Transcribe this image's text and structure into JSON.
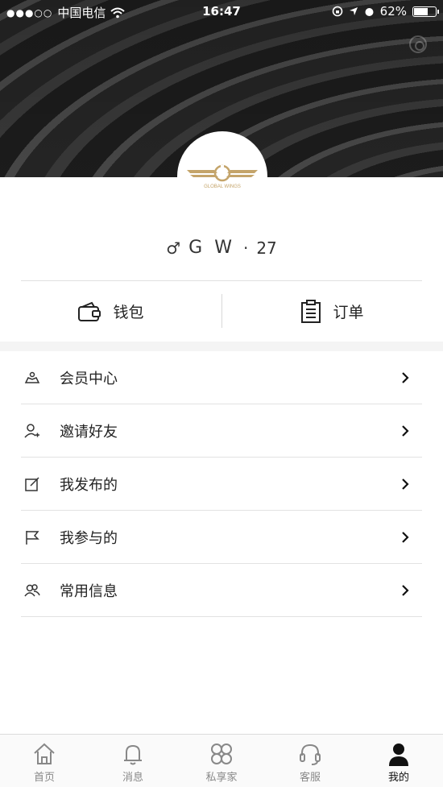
{
  "status_bar": {
    "carrier": "中国电信",
    "time": "16:47",
    "battery": "62%",
    "battery_level": 0.62
  },
  "profile": {
    "gender_symbol": "♂",
    "name": "G W",
    "separator": "·",
    "age": "27",
    "logo_text": "GLOBAL WINGS"
  },
  "quick_actions": [
    {
      "label": "钱包",
      "icon": "wallet-icon"
    },
    {
      "label": "订单",
      "icon": "clipboard-icon"
    }
  ],
  "menu": [
    {
      "label": "会员中心",
      "icon": "member-icon"
    },
    {
      "label": "邀请好友",
      "icon": "add-friend-icon"
    },
    {
      "label": "我发布的",
      "icon": "edit-icon"
    },
    {
      "label": "我参与的",
      "icon": "flag-icon"
    },
    {
      "label": "常用信息",
      "icon": "contacts-icon"
    }
  ],
  "tabs": [
    {
      "label": "首页",
      "icon": "home-icon",
      "active": false
    },
    {
      "label": "消息",
      "icon": "bell-icon",
      "active": false
    },
    {
      "label": "私享家",
      "icon": "clover-icon",
      "active": false
    },
    {
      "label": "客服",
      "icon": "headset-icon",
      "active": false
    },
    {
      "label": "我的",
      "icon": "person-icon",
      "active": true
    }
  ],
  "colors": {
    "logo_gold": "#c4a46a",
    "active_tab": "#111111",
    "inactive_tab": "#888888"
  }
}
